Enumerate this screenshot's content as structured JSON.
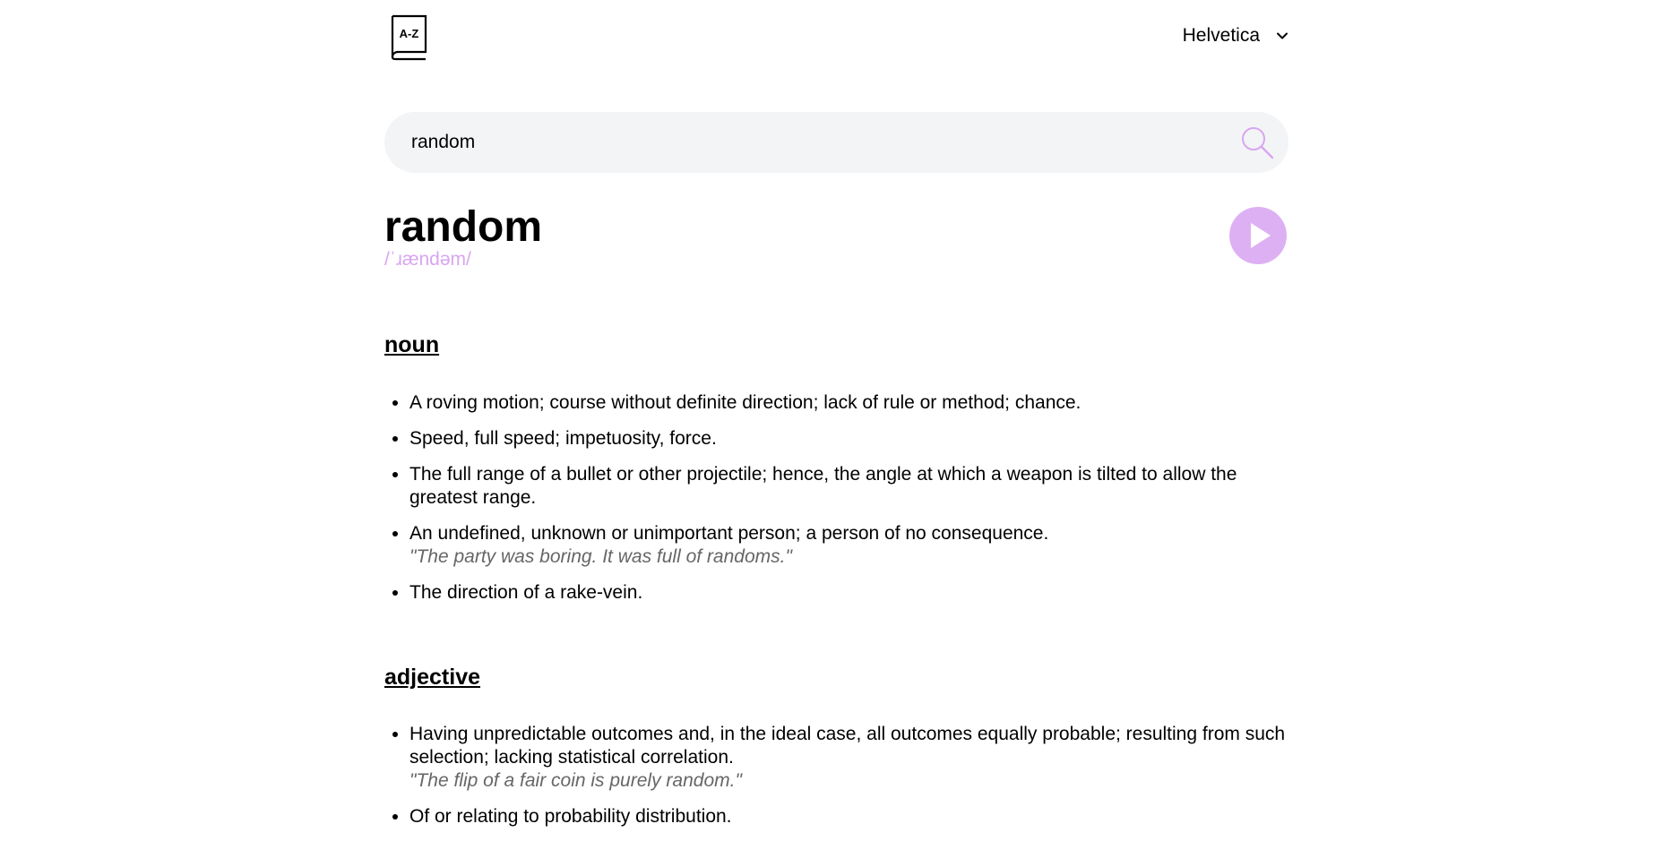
{
  "header": {
    "logo_icon": "book-az-icon",
    "font_label": "Helvetica",
    "font_chevron_icon": "chevron-down-icon"
  },
  "search": {
    "value": "random",
    "icon": "search-icon"
  },
  "word": {
    "title": "random",
    "phonetic": "/ˈɹændəm/",
    "play_icon": "play-icon"
  },
  "colors": {
    "accent": "#d8a6ef",
    "play_bg": "#ddb0f3",
    "search_bg": "#f3f4f6",
    "example_text": "#666666"
  },
  "meanings": [
    {
      "part_of_speech": "noun",
      "definitions": [
        {
          "text": "A roving motion; course without definite direction; lack of rule or method; chance.",
          "example": ""
        },
        {
          "text": "Speed, full speed; impetuosity, force.",
          "example": ""
        },
        {
          "text": "The full range of a bullet or other projectile; hence, the angle at which a weapon is tilted to allow the greatest range.",
          "example": ""
        },
        {
          "text": "An undefined, unknown or unimportant person; a person of no consequence.",
          "example": "\"The party was boring. It was full of randoms.\""
        },
        {
          "text": "The direction of a rake-vein.",
          "example": ""
        }
      ]
    },
    {
      "part_of_speech": "adjective",
      "definitions": [
        {
          "text": "Having unpredictable outcomes and, in the ideal case, all outcomes equally probable; resulting from such selection; lacking statistical correlation.",
          "example": "\"The flip of a fair coin is purely random.\""
        },
        {
          "text": "Of or relating to probability distribution.",
          "example": ""
        }
      ]
    }
  ]
}
